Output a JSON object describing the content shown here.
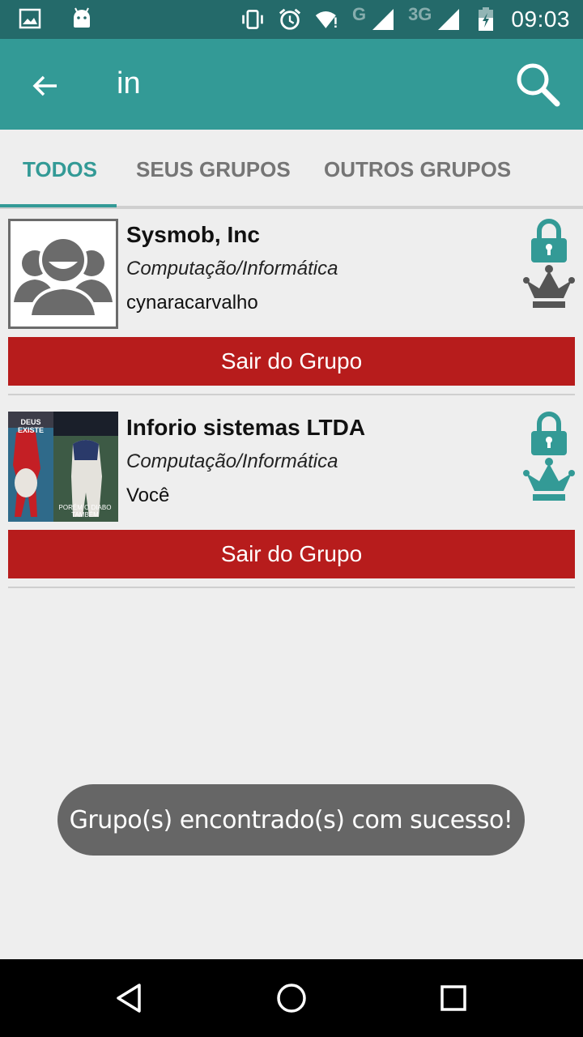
{
  "status_bar": {
    "network_g": "G",
    "network_3g": "3G",
    "time": "09:03",
    "icons": [
      "image-icon",
      "android-icon",
      "vibrate-icon",
      "alarm-icon",
      "wifi-icon",
      "signal-icon",
      "signal-3g-icon",
      "battery-icon"
    ]
  },
  "app_bar": {
    "title": "in",
    "back_icon": "arrow-back-icon",
    "search_icon": "search-icon",
    "color": "#339a96"
  },
  "tabs": [
    {
      "label": "TODOS",
      "active": true
    },
    {
      "label": "SEUS GRUPOS",
      "active": false
    },
    {
      "label": "OUTROS GRUPOS",
      "active": false
    }
  ],
  "groups": [
    {
      "name": "Sysmob, Inc",
      "category": "Computação/Informática",
      "owner": "cynaracarvalho",
      "avatar": "default-group-avatar",
      "lock_color": "#339a96",
      "crown_color": "#555555",
      "button_label": "Sair do Grupo"
    },
    {
      "name": "Inforio sistemas LTDA",
      "category": "Computação/Informática",
      "owner": "Você",
      "avatar": "photo-avatar",
      "avatar_text_top": "DEUS EXISTE",
      "avatar_text_bottom": "PORÉM O DIABO TAMBÉM",
      "lock_color": "#339a96",
      "crown_color": "#339a96",
      "button_label": "Sair do Grupo"
    }
  ],
  "toast": {
    "message": "Grupo(s) encontrado(s) com sucesso!"
  },
  "colors": {
    "primary": "#339a96",
    "status_bar": "#246a6a",
    "button": "#b71c1c",
    "background": "#eeeeee"
  }
}
